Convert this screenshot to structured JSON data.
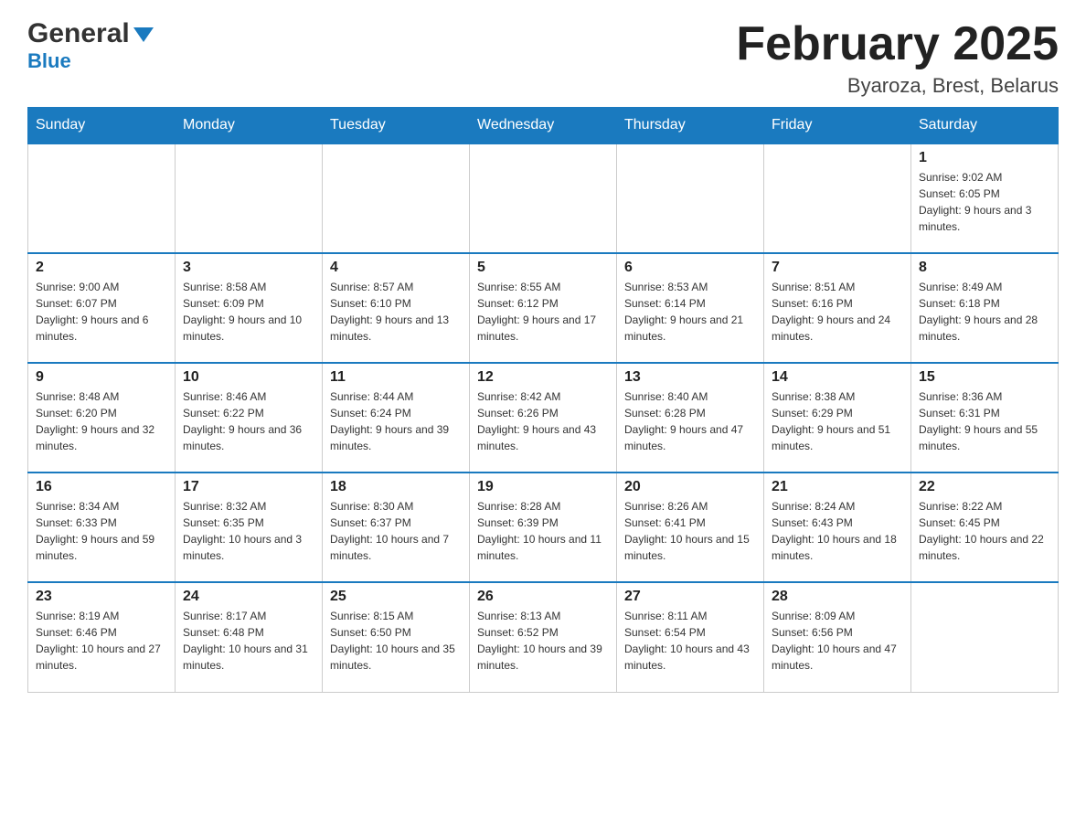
{
  "header": {
    "logo": {
      "general": "General",
      "blue": "Blue",
      "triangle_color": "#1a7abf"
    },
    "month_title": "February 2025",
    "location": "Byaroza, Brest, Belarus"
  },
  "days_of_week": [
    "Sunday",
    "Monday",
    "Tuesday",
    "Wednesday",
    "Thursday",
    "Friday",
    "Saturday"
  ],
  "weeks": [
    {
      "days": [
        {
          "date": "",
          "info": ""
        },
        {
          "date": "",
          "info": ""
        },
        {
          "date": "",
          "info": ""
        },
        {
          "date": "",
          "info": ""
        },
        {
          "date": "",
          "info": ""
        },
        {
          "date": "",
          "info": ""
        },
        {
          "date": "1",
          "info": "Sunrise: 9:02 AM\nSunset: 6:05 PM\nDaylight: 9 hours and 3 minutes."
        }
      ]
    },
    {
      "days": [
        {
          "date": "2",
          "info": "Sunrise: 9:00 AM\nSunset: 6:07 PM\nDaylight: 9 hours and 6 minutes."
        },
        {
          "date": "3",
          "info": "Sunrise: 8:58 AM\nSunset: 6:09 PM\nDaylight: 9 hours and 10 minutes."
        },
        {
          "date": "4",
          "info": "Sunrise: 8:57 AM\nSunset: 6:10 PM\nDaylight: 9 hours and 13 minutes."
        },
        {
          "date": "5",
          "info": "Sunrise: 8:55 AM\nSunset: 6:12 PM\nDaylight: 9 hours and 17 minutes."
        },
        {
          "date": "6",
          "info": "Sunrise: 8:53 AM\nSunset: 6:14 PM\nDaylight: 9 hours and 21 minutes."
        },
        {
          "date": "7",
          "info": "Sunrise: 8:51 AM\nSunset: 6:16 PM\nDaylight: 9 hours and 24 minutes."
        },
        {
          "date": "8",
          "info": "Sunrise: 8:49 AM\nSunset: 6:18 PM\nDaylight: 9 hours and 28 minutes."
        }
      ]
    },
    {
      "days": [
        {
          "date": "9",
          "info": "Sunrise: 8:48 AM\nSunset: 6:20 PM\nDaylight: 9 hours and 32 minutes."
        },
        {
          "date": "10",
          "info": "Sunrise: 8:46 AM\nSunset: 6:22 PM\nDaylight: 9 hours and 36 minutes."
        },
        {
          "date": "11",
          "info": "Sunrise: 8:44 AM\nSunset: 6:24 PM\nDaylight: 9 hours and 39 minutes."
        },
        {
          "date": "12",
          "info": "Sunrise: 8:42 AM\nSunset: 6:26 PM\nDaylight: 9 hours and 43 minutes."
        },
        {
          "date": "13",
          "info": "Sunrise: 8:40 AM\nSunset: 6:28 PM\nDaylight: 9 hours and 47 minutes."
        },
        {
          "date": "14",
          "info": "Sunrise: 8:38 AM\nSunset: 6:29 PM\nDaylight: 9 hours and 51 minutes."
        },
        {
          "date": "15",
          "info": "Sunrise: 8:36 AM\nSunset: 6:31 PM\nDaylight: 9 hours and 55 minutes."
        }
      ]
    },
    {
      "days": [
        {
          "date": "16",
          "info": "Sunrise: 8:34 AM\nSunset: 6:33 PM\nDaylight: 9 hours and 59 minutes."
        },
        {
          "date": "17",
          "info": "Sunrise: 8:32 AM\nSunset: 6:35 PM\nDaylight: 10 hours and 3 minutes."
        },
        {
          "date": "18",
          "info": "Sunrise: 8:30 AM\nSunset: 6:37 PM\nDaylight: 10 hours and 7 minutes."
        },
        {
          "date": "19",
          "info": "Sunrise: 8:28 AM\nSunset: 6:39 PM\nDaylight: 10 hours and 11 minutes."
        },
        {
          "date": "20",
          "info": "Sunrise: 8:26 AM\nSunset: 6:41 PM\nDaylight: 10 hours and 15 minutes."
        },
        {
          "date": "21",
          "info": "Sunrise: 8:24 AM\nSunset: 6:43 PM\nDaylight: 10 hours and 18 minutes."
        },
        {
          "date": "22",
          "info": "Sunrise: 8:22 AM\nSunset: 6:45 PM\nDaylight: 10 hours and 22 minutes."
        }
      ]
    },
    {
      "days": [
        {
          "date": "23",
          "info": "Sunrise: 8:19 AM\nSunset: 6:46 PM\nDaylight: 10 hours and 27 minutes."
        },
        {
          "date": "24",
          "info": "Sunrise: 8:17 AM\nSunset: 6:48 PM\nDaylight: 10 hours and 31 minutes."
        },
        {
          "date": "25",
          "info": "Sunrise: 8:15 AM\nSunset: 6:50 PM\nDaylight: 10 hours and 35 minutes."
        },
        {
          "date": "26",
          "info": "Sunrise: 8:13 AM\nSunset: 6:52 PM\nDaylight: 10 hours and 39 minutes."
        },
        {
          "date": "27",
          "info": "Sunrise: 8:11 AM\nSunset: 6:54 PM\nDaylight: 10 hours and 43 minutes."
        },
        {
          "date": "28",
          "info": "Sunrise: 8:09 AM\nSunset: 6:56 PM\nDaylight: 10 hours and 47 minutes."
        },
        {
          "date": "",
          "info": ""
        }
      ]
    }
  ]
}
